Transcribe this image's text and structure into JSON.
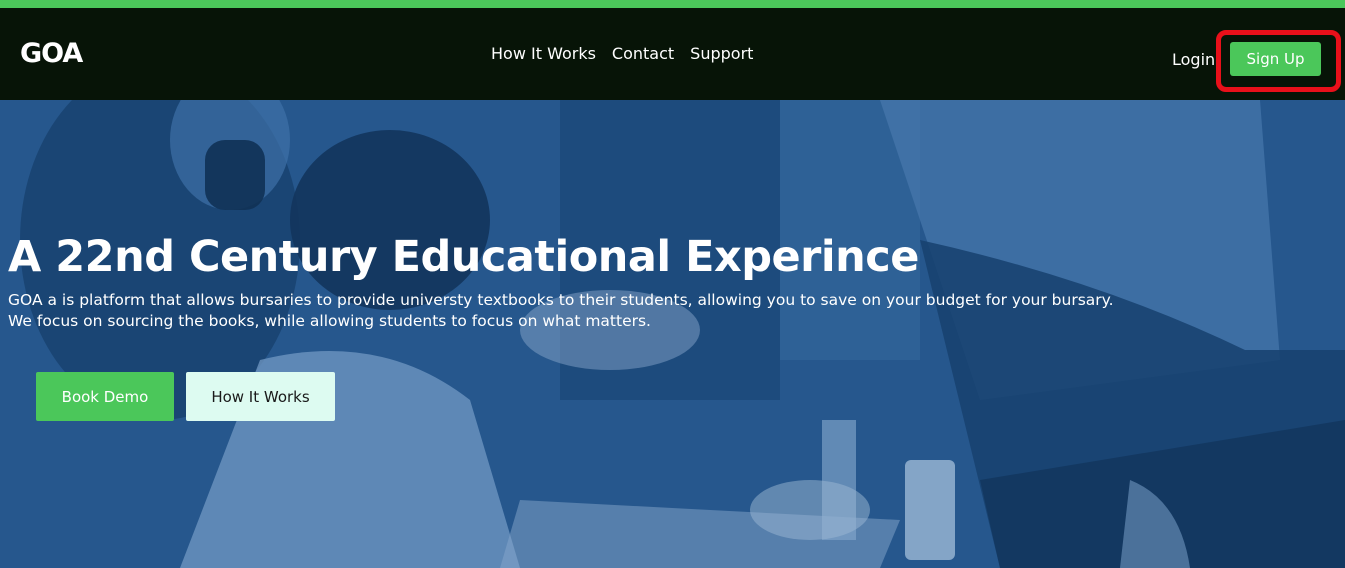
{
  "brand": {
    "logo_text": "GOA",
    "accent": "#4bc75a",
    "highlight": "#e8101a"
  },
  "nav": {
    "links": [
      "How It Works",
      "Contact",
      "Support"
    ],
    "login_label": "Login",
    "signup_label": "Sign Up"
  },
  "hero": {
    "title": "A 22nd Century Educational Experince",
    "subtitle_line1": "GOA a is platform that allows bursaries to provide universty textbooks to their students, allowing you to save on your budget for your bursary.",
    "subtitle_line2": "We focus on sourcing the books, while allowing students to focus on what matters.",
    "primary_button": "Book Demo",
    "secondary_button": "How It Works",
    "background_image": "students-studying-photo"
  }
}
